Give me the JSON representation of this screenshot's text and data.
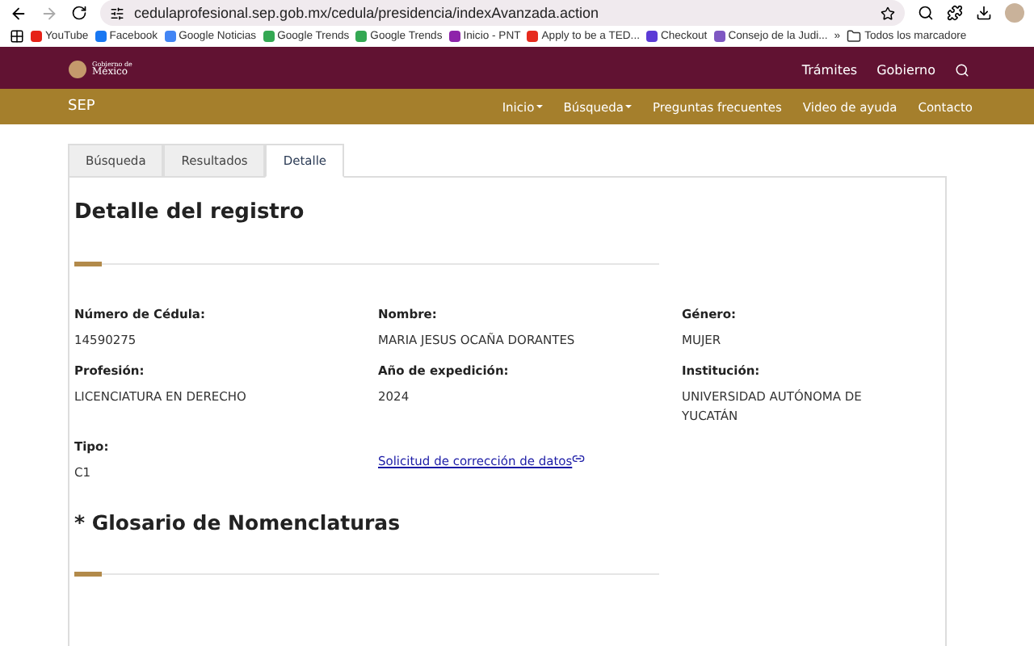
{
  "browser": {
    "url": "cedulaprofesional.sep.gob.mx/cedula/presidencia/indexAvanzada.action",
    "bookmarks": [
      {
        "label": "YouTube",
        "color": "#e62117"
      },
      {
        "label": "Facebook",
        "color": "#1877f2"
      },
      {
        "label": "Google Noticias",
        "color": "#4285f4"
      },
      {
        "label": "Google Trends",
        "color": "#34a853"
      },
      {
        "label": "Google Trends",
        "color": "#34a853"
      },
      {
        "label": "Inicio - PNT",
        "color": "#8e24aa"
      },
      {
        "label": "Apply to be a TED...",
        "color": "#e62b1e"
      },
      {
        "label": "Checkout",
        "color": "#5c3bd6"
      },
      {
        "label": "Consejo de la Judi...",
        "color": "#7e57c2"
      }
    ],
    "more": "»",
    "all_bookmarks": "Todos los marcadore"
  },
  "header": {
    "logo_lines": [
      "Gobierno de",
      "México"
    ],
    "links": [
      "Trámites",
      "Gobierno"
    ]
  },
  "subnav": {
    "brand": "SEP",
    "items": [
      {
        "label": "Inicio",
        "dropdown": true
      },
      {
        "label": "Búsqueda",
        "dropdown": true
      },
      {
        "label": "Preguntas frecuentes",
        "dropdown": false
      },
      {
        "label": "Video de ayuda",
        "dropdown": false
      },
      {
        "label": "Contacto",
        "dropdown": false
      }
    ]
  },
  "tabs": [
    {
      "label": "Búsqueda",
      "selected": false
    },
    {
      "label": "Resultados",
      "selected": false
    },
    {
      "label": "Detalle",
      "selected": true
    }
  ],
  "detail": {
    "title": "Detalle del registro",
    "fields": [
      {
        "label": "Número de Cédula:",
        "value": "14590275"
      },
      {
        "label": "Nombre:",
        "value": "MARIA JESUS OCAÑA DORANTES"
      },
      {
        "label": "Género:",
        "value": "MUJER"
      },
      {
        "label": "Profesión:",
        "value": "LICENCIATURA EN DERECHO"
      },
      {
        "label": "Año de expedición:",
        "value": "2024"
      },
      {
        "label": "Institución:",
        "value": "UNIVERSIDAD AUTÓNOMA DE YUCATÁN"
      },
      {
        "label": "Tipo:",
        "value": "C1"
      }
    ],
    "link": "Solicitud de corrección de datos",
    "glossary_title": "* Glosario de Nomenclaturas"
  }
}
